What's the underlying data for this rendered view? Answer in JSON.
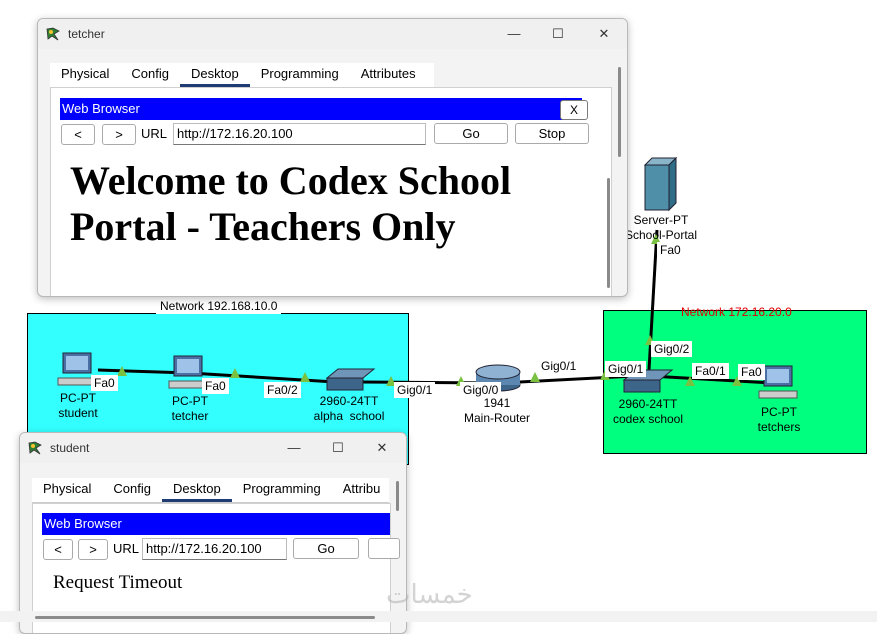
{
  "topology": {
    "networks": {
      "left_label": "Network 192.168.10.0",
      "right_label": "Network 172.16.20.0",
      "left_color": "#33ffff",
      "right_color": "#00ff7f"
    },
    "devices": {
      "student_pc": {
        "type": "PC-PT",
        "name": "student",
        "port": "Fa0"
      },
      "tetcher_pc": {
        "type": "PC-PT",
        "name": "tetcher",
        "port": "Fa0"
      },
      "alpha_switch": {
        "type": "2960-24TT",
        "name": "alpha  school",
        "port_left": "Fa0/2",
        "port_right": "Gig0/1"
      },
      "router": {
        "type": "1941",
        "name": "Main-Router",
        "port_left": "Gig0/0",
        "port_right": "Gig0/1"
      },
      "codex_switch": {
        "type": "2960-24TT",
        "name": "codex school",
        "port_left": "Gig0/1",
        "port_up": "Gig0/2",
        "port_right": "Fa0/1"
      },
      "server": {
        "type": "Server-PT",
        "name": "School-Portal",
        "port": "Fa0"
      },
      "tetchers_pc": {
        "type": "PC-PT",
        "name": "tetchers",
        "port": "Fa0"
      }
    }
  },
  "tetcher_window": {
    "title": "tetcher",
    "tabs": [
      "Physical",
      "Config",
      "Desktop",
      "Programming",
      "Attributes"
    ],
    "active_tab": "Desktop",
    "browser": {
      "bar_title": "Web Browser",
      "close_label": "X",
      "back_label": "<",
      "forward_label": ">",
      "url_label": "URL",
      "url_value": "http://172.16.20.100",
      "go_label": "Go",
      "stop_label": "Stop",
      "page_heading": "Welcome to Codex School Portal - Teachers Only"
    }
  },
  "student_window": {
    "title": "student",
    "tabs": [
      "Physical",
      "Config",
      "Desktop",
      "Programming",
      "Attribu"
    ],
    "active_tab": "Desktop",
    "browser": {
      "bar_title": "Web Browser",
      "back_label": "<",
      "forward_label": ">",
      "url_label": "URL",
      "url_value": "http://172.16.20.100",
      "go_label": "Go",
      "page_message": "Request Timeout"
    }
  },
  "window_controls": {
    "minimize": "—",
    "maximize": "☐",
    "close": "✕"
  },
  "watermark": "خمسات"
}
